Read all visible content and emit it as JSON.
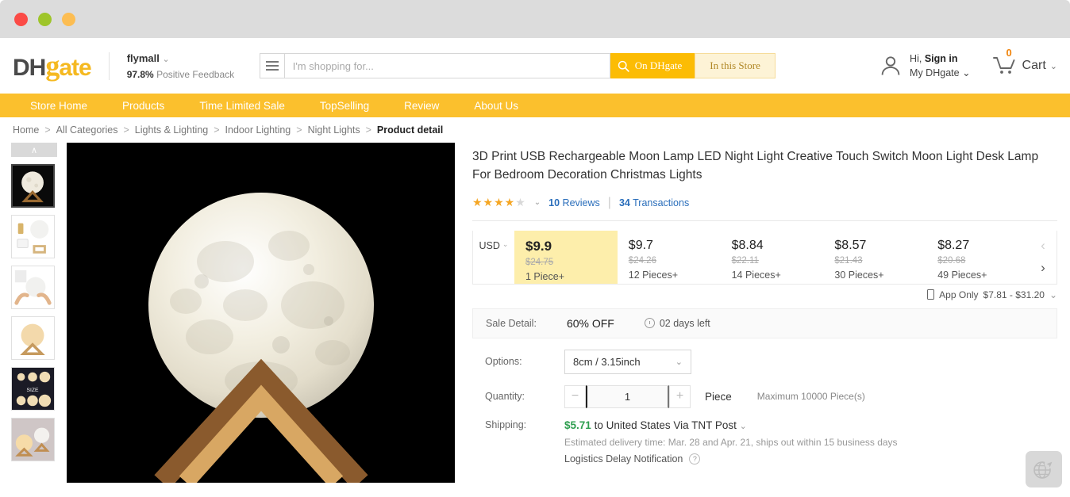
{
  "window": {
    "dots": [
      "red",
      "green",
      "yellow"
    ]
  },
  "header": {
    "logo": {
      "dh": "DH",
      "g": "g",
      "ate": "ate"
    },
    "store": {
      "name": "flymall",
      "caret": "⌄",
      "feedback_pct": "97.8%",
      "feedback_label": "Positive Feedback"
    },
    "search": {
      "placeholder": "I'm shopping for...",
      "value": "",
      "btn_on_dhgate": "On DHgate",
      "btn_in_store": "In this Store"
    },
    "account": {
      "greeting_prefix": "Hi,",
      "signin": "Sign in",
      "my_account": "My DHgate",
      "caret": "⌄"
    },
    "cart": {
      "label": "Cart",
      "count": "0",
      "caret": "⌄"
    }
  },
  "nav": {
    "items": [
      {
        "label": "Store Home"
      },
      {
        "label": "Products"
      },
      {
        "label": "Time Limited Sale"
      },
      {
        "label": "TopSelling"
      },
      {
        "label": "Review"
      },
      {
        "label": "About Us"
      }
    ]
  },
  "breadcrumb": {
    "items": [
      "Home",
      "All Categories",
      "Lights & Lighting",
      "Indoor Lighting",
      "Night Lights"
    ],
    "current": "Product detail",
    "separator": ">"
  },
  "gallery": {
    "scroll_up": "∧",
    "thumbs": [
      {
        "alt": "moon-lamp-on-wood-stand-dark"
      },
      {
        "alt": "package-contents-white-sphere"
      },
      {
        "alt": "hands-touching-lamp"
      },
      {
        "alt": "warm-glow-lamp-on-stand"
      },
      {
        "alt": "size-comparison-chart"
      },
      {
        "alt": "two-lamps-bedroom-scene"
      }
    ],
    "active_index": 0,
    "hero_alt": "3d-print-moon-lamp-glowing-on-wooden-stand"
  },
  "product": {
    "title": "3D Print USB Rechargeable Moon Lamp LED Night Light Creative Touch Switch Moon Light Desk Lamp For Bedroom Decoration Christmas Lights",
    "rating": 4.5,
    "rating_caret": "⌄",
    "reviews_count": "10",
    "reviews_label": "Reviews",
    "transactions_count": "34",
    "transactions_label": "Transactions",
    "divider": "|"
  },
  "pricing": {
    "currency": "USD",
    "currency_caret": "⌄",
    "tiers": [
      {
        "price": "$9.9",
        "original": "$24.75",
        "qty": "1 Piece+",
        "highlighted": true
      },
      {
        "price": "$9.7",
        "original": "$24.26",
        "qty": "12 Pieces+",
        "highlighted": false
      },
      {
        "price": "$8.84",
        "original": "$22.11",
        "qty": "14 Pieces+",
        "highlighted": false
      },
      {
        "price": "$8.57",
        "original": "$21.43",
        "qty": "30 Pieces+",
        "highlighted": false
      },
      {
        "price": "$8.27",
        "original": "$20.68",
        "qty": "49 Pieces+",
        "highlighted": false
      }
    ],
    "prev_arrow": "‹",
    "next_arrow": "›",
    "app_only": {
      "label": "App Only",
      "range": "$7.81 - $31.20",
      "caret": "⌄"
    }
  },
  "sale": {
    "label": "Sale Detail:",
    "discount": "60% OFF",
    "time_left": "02 days left"
  },
  "options": {
    "label": "Options:",
    "selected": "8cm / 3.15inch",
    "caret": "⌄"
  },
  "quantity": {
    "label": "Quantity:",
    "minus": "−",
    "plus": "+",
    "value": "1",
    "unit": "Piece",
    "max_note": "Maximum 10000 Piece(s)"
  },
  "shipping": {
    "label": "Shipping:",
    "cost": "$5.71",
    "to_text": "to United States Via TNT Post",
    "caret": "⌄",
    "estimate": "Estimated delivery time: Mar. 28 and Apr. 21, ships out within 15 business days",
    "delay_notice": "Logistics Delay Notification",
    "help_icon": "?"
  },
  "widgets": {
    "globe_alt": "globe-with-airplane"
  },
  "colors": {
    "brand_yellow": "#fbc02d",
    "search_btn": "#fcbc04",
    "tier_highlight": "#fdeeab",
    "link_blue": "#2a6ebb",
    "ship_green": "#2e9e4f",
    "star_gold": "#f5a623"
  }
}
